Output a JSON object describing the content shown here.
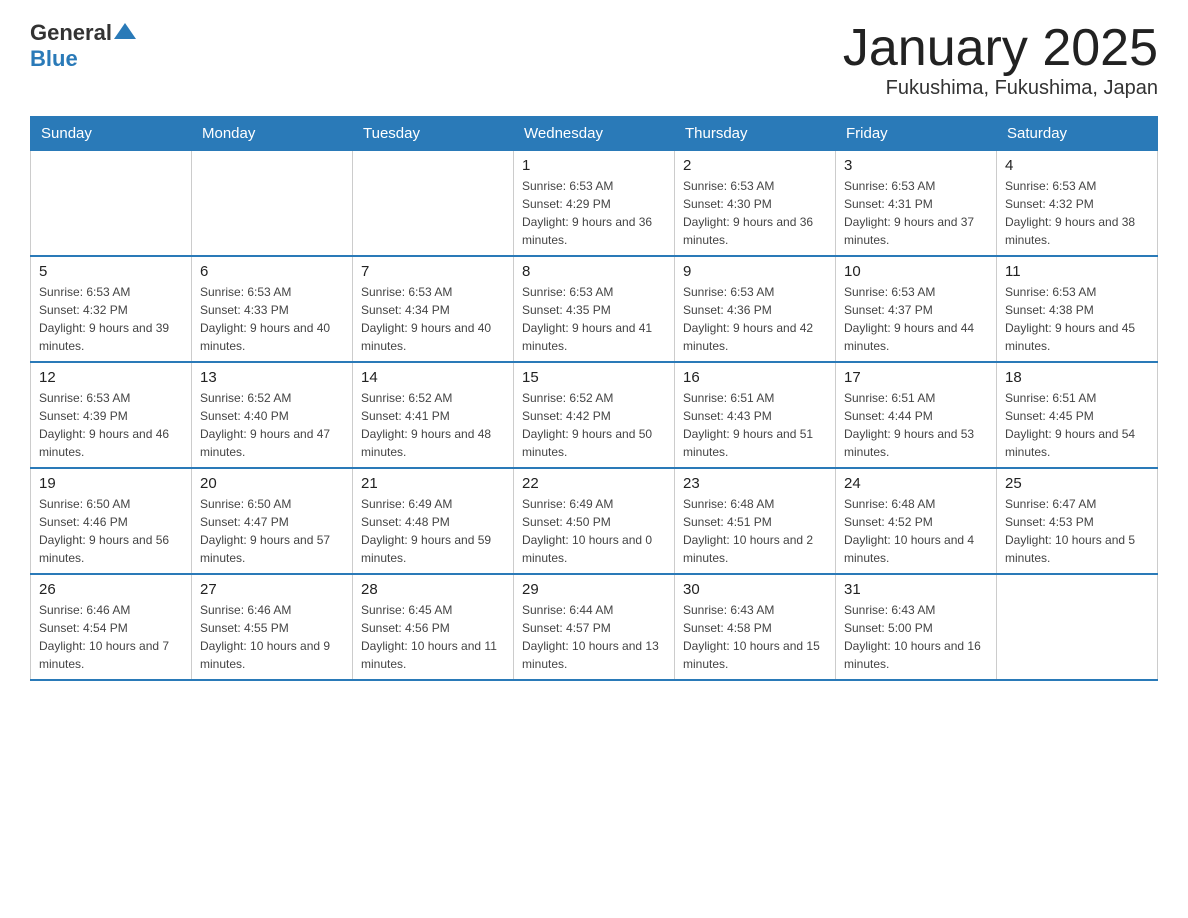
{
  "header": {
    "logo": {
      "general": "General",
      "triangle": "▲",
      "blue": "Blue"
    },
    "title": "January 2025",
    "subtitle": "Fukushima, Fukushima, Japan"
  },
  "days_of_week": [
    "Sunday",
    "Monday",
    "Tuesday",
    "Wednesday",
    "Thursday",
    "Friday",
    "Saturday"
  ],
  "weeks": [
    [
      {
        "day": "",
        "info": ""
      },
      {
        "day": "",
        "info": ""
      },
      {
        "day": "",
        "info": ""
      },
      {
        "day": "1",
        "info": "Sunrise: 6:53 AM\nSunset: 4:29 PM\nDaylight: 9 hours and 36 minutes."
      },
      {
        "day": "2",
        "info": "Sunrise: 6:53 AM\nSunset: 4:30 PM\nDaylight: 9 hours and 36 minutes."
      },
      {
        "day": "3",
        "info": "Sunrise: 6:53 AM\nSunset: 4:31 PM\nDaylight: 9 hours and 37 minutes."
      },
      {
        "day": "4",
        "info": "Sunrise: 6:53 AM\nSunset: 4:32 PM\nDaylight: 9 hours and 38 minutes."
      }
    ],
    [
      {
        "day": "5",
        "info": "Sunrise: 6:53 AM\nSunset: 4:32 PM\nDaylight: 9 hours and 39 minutes."
      },
      {
        "day": "6",
        "info": "Sunrise: 6:53 AM\nSunset: 4:33 PM\nDaylight: 9 hours and 40 minutes."
      },
      {
        "day": "7",
        "info": "Sunrise: 6:53 AM\nSunset: 4:34 PM\nDaylight: 9 hours and 40 minutes."
      },
      {
        "day": "8",
        "info": "Sunrise: 6:53 AM\nSunset: 4:35 PM\nDaylight: 9 hours and 41 minutes."
      },
      {
        "day": "9",
        "info": "Sunrise: 6:53 AM\nSunset: 4:36 PM\nDaylight: 9 hours and 42 minutes."
      },
      {
        "day": "10",
        "info": "Sunrise: 6:53 AM\nSunset: 4:37 PM\nDaylight: 9 hours and 44 minutes."
      },
      {
        "day": "11",
        "info": "Sunrise: 6:53 AM\nSunset: 4:38 PM\nDaylight: 9 hours and 45 minutes."
      }
    ],
    [
      {
        "day": "12",
        "info": "Sunrise: 6:53 AM\nSunset: 4:39 PM\nDaylight: 9 hours and 46 minutes."
      },
      {
        "day": "13",
        "info": "Sunrise: 6:52 AM\nSunset: 4:40 PM\nDaylight: 9 hours and 47 minutes."
      },
      {
        "day": "14",
        "info": "Sunrise: 6:52 AM\nSunset: 4:41 PM\nDaylight: 9 hours and 48 minutes."
      },
      {
        "day": "15",
        "info": "Sunrise: 6:52 AM\nSunset: 4:42 PM\nDaylight: 9 hours and 50 minutes."
      },
      {
        "day": "16",
        "info": "Sunrise: 6:51 AM\nSunset: 4:43 PM\nDaylight: 9 hours and 51 minutes."
      },
      {
        "day": "17",
        "info": "Sunrise: 6:51 AM\nSunset: 4:44 PM\nDaylight: 9 hours and 53 minutes."
      },
      {
        "day": "18",
        "info": "Sunrise: 6:51 AM\nSunset: 4:45 PM\nDaylight: 9 hours and 54 minutes."
      }
    ],
    [
      {
        "day": "19",
        "info": "Sunrise: 6:50 AM\nSunset: 4:46 PM\nDaylight: 9 hours and 56 minutes."
      },
      {
        "day": "20",
        "info": "Sunrise: 6:50 AM\nSunset: 4:47 PM\nDaylight: 9 hours and 57 minutes."
      },
      {
        "day": "21",
        "info": "Sunrise: 6:49 AM\nSunset: 4:48 PM\nDaylight: 9 hours and 59 minutes."
      },
      {
        "day": "22",
        "info": "Sunrise: 6:49 AM\nSunset: 4:50 PM\nDaylight: 10 hours and 0 minutes."
      },
      {
        "day": "23",
        "info": "Sunrise: 6:48 AM\nSunset: 4:51 PM\nDaylight: 10 hours and 2 minutes."
      },
      {
        "day": "24",
        "info": "Sunrise: 6:48 AM\nSunset: 4:52 PM\nDaylight: 10 hours and 4 minutes."
      },
      {
        "day": "25",
        "info": "Sunrise: 6:47 AM\nSunset: 4:53 PM\nDaylight: 10 hours and 5 minutes."
      }
    ],
    [
      {
        "day": "26",
        "info": "Sunrise: 6:46 AM\nSunset: 4:54 PM\nDaylight: 10 hours and 7 minutes."
      },
      {
        "day": "27",
        "info": "Sunrise: 6:46 AM\nSunset: 4:55 PM\nDaylight: 10 hours and 9 minutes."
      },
      {
        "day": "28",
        "info": "Sunrise: 6:45 AM\nSunset: 4:56 PM\nDaylight: 10 hours and 11 minutes."
      },
      {
        "day": "29",
        "info": "Sunrise: 6:44 AM\nSunset: 4:57 PM\nDaylight: 10 hours and 13 minutes."
      },
      {
        "day": "30",
        "info": "Sunrise: 6:43 AM\nSunset: 4:58 PM\nDaylight: 10 hours and 15 minutes."
      },
      {
        "day": "31",
        "info": "Sunrise: 6:43 AM\nSunset: 5:00 PM\nDaylight: 10 hours and 16 minutes."
      },
      {
        "day": "",
        "info": ""
      }
    ]
  ]
}
